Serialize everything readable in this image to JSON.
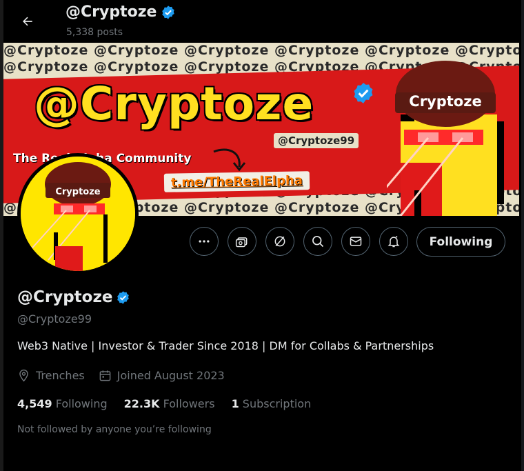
{
  "header": {
    "title": "@Cryptoze",
    "posts": "5,338 posts"
  },
  "banner": {
    "pattern_text": "@Cryptoze @Cryptoze @Cryptoze @Cryptoze @Cryptoze @Cryptoze",
    "big_title": "@Cryptoze",
    "subheading": "The Real Alpha Community",
    "handle_tag": "@Cryptoze99",
    "link": "t.me/TheRealElpha",
    "hat_text": "Cryptoze"
  },
  "avatar": {
    "hat_text": "Cryptoze"
  },
  "actions": {
    "following_label": "Following",
    "icons": [
      "more-icon",
      "subscribe-icon",
      "grok-icon",
      "search-icon",
      "message-icon",
      "notification-icon"
    ]
  },
  "profile": {
    "name": "@Cryptoze",
    "handle": "@Cryptoze99",
    "bio": "Web3 Native | Investor & Trader Since 2018 | DM for Collabs & Partnerships",
    "location": "Trenches",
    "joined": "Joined August 2023"
  },
  "stats": {
    "following_count": "4,549",
    "following_label": "Following",
    "followers_count": "22.3K",
    "followers_label": "Followers",
    "subscription_count": "1",
    "subscription_label": "Subscription"
  },
  "not_followed": "Not followed by anyone you’re following",
  "colors": {
    "verified": "#1d9bf0",
    "accent_yellow": "#ffe020",
    "banner_red": "#d81919"
  }
}
